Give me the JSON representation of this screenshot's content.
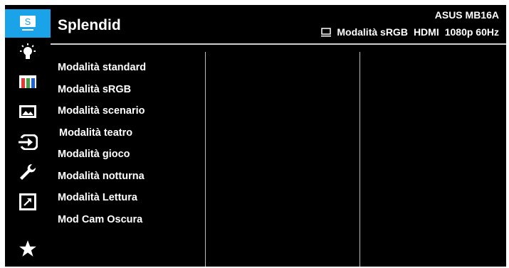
{
  "header": {
    "title": "Splendid",
    "model": "ASUS MB16A",
    "status": {
      "mode": "Modalità sRGB",
      "input": "HDMI",
      "resolution": "1080p 60Hz"
    }
  },
  "sidebar": {
    "items": [
      {
        "icon": "splendid-s-icon",
        "active": true,
        "text": "S"
      },
      {
        "icon": "brightness-bulb-icon"
      },
      {
        "icon": "color-bars-icon"
      },
      {
        "icon": "image-icon"
      },
      {
        "icon": "input-select-icon"
      },
      {
        "icon": "wrench-icon"
      },
      {
        "icon": "shortcut-arrow-icon"
      },
      {
        "icon": "star-icon"
      }
    ]
  },
  "menu": {
    "items": [
      "Modalità standard",
      "Modalità sRGB",
      "Modalità scenario",
      "Modalità teatro",
      "Modalità gioco",
      "Modalità notturna",
      "Modalità Lettura",
      "Mod Cam Oscura"
    ]
  },
  "colors": {
    "accent": "#1aa3e8",
    "background": "#000000",
    "text": "#ffffff",
    "divider": "#cfcfcf"
  }
}
